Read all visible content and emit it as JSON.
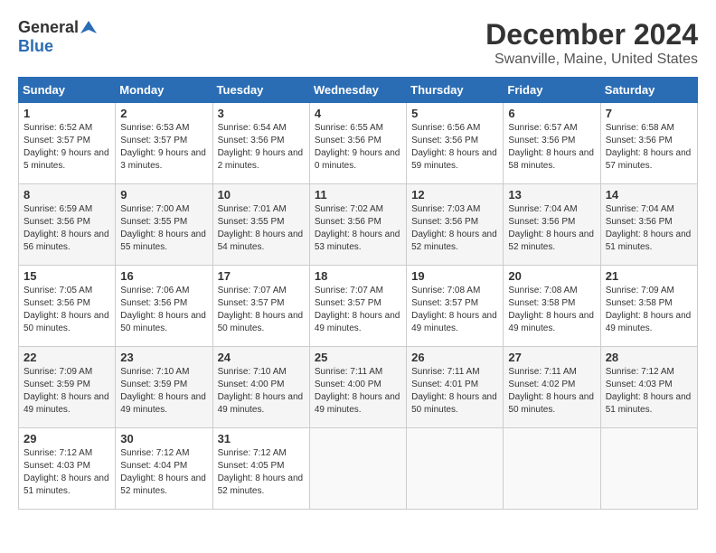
{
  "logo": {
    "general": "General",
    "blue": "Blue"
  },
  "title": "December 2024",
  "location": "Swanville, Maine, United States",
  "days_of_week": [
    "Sunday",
    "Monday",
    "Tuesday",
    "Wednesday",
    "Thursday",
    "Friday",
    "Saturday"
  ],
  "weeks": [
    [
      {
        "day": 1,
        "sunrise": "6:52 AM",
        "sunset": "3:57 PM",
        "daylight": "9 hours and 5 minutes."
      },
      {
        "day": 2,
        "sunrise": "6:53 AM",
        "sunset": "3:57 PM",
        "daylight": "9 hours and 3 minutes."
      },
      {
        "day": 3,
        "sunrise": "6:54 AM",
        "sunset": "3:56 PM",
        "daylight": "9 hours and 2 minutes."
      },
      {
        "day": 4,
        "sunrise": "6:55 AM",
        "sunset": "3:56 PM",
        "daylight": "9 hours and 0 minutes."
      },
      {
        "day": 5,
        "sunrise": "6:56 AM",
        "sunset": "3:56 PM",
        "daylight": "8 hours and 59 minutes."
      },
      {
        "day": 6,
        "sunrise": "6:57 AM",
        "sunset": "3:56 PM",
        "daylight": "8 hours and 58 minutes."
      },
      {
        "day": 7,
        "sunrise": "6:58 AM",
        "sunset": "3:56 PM",
        "daylight": "8 hours and 57 minutes."
      }
    ],
    [
      {
        "day": 8,
        "sunrise": "6:59 AM",
        "sunset": "3:56 PM",
        "daylight": "8 hours and 56 minutes."
      },
      {
        "day": 9,
        "sunrise": "7:00 AM",
        "sunset": "3:55 PM",
        "daylight": "8 hours and 55 minutes."
      },
      {
        "day": 10,
        "sunrise": "7:01 AM",
        "sunset": "3:55 PM",
        "daylight": "8 hours and 54 minutes."
      },
      {
        "day": 11,
        "sunrise": "7:02 AM",
        "sunset": "3:56 PM",
        "daylight": "8 hours and 53 minutes."
      },
      {
        "day": 12,
        "sunrise": "7:03 AM",
        "sunset": "3:56 PM",
        "daylight": "8 hours and 52 minutes."
      },
      {
        "day": 13,
        "sunrise": "7:04 AM",
        "sunset": "3:56 PM",
        "daylight": "8 hours and 52 minutes."
      },
      {
        "day": 14,
        "sunrise": "7:04 AM",
        "sunset": "3:56 PM",
        "daylight": "8 hours and 51 minutes."
      }
    ],
    [
      {
        "day": 15,
        "sunrise": "7:05 AM",
        "sunset": "3:56 PM",
        "daylight": "8 hours and 50 minutes."
      },
      {
        "day": 16,
        "sunrise": "7:06 AM",
        "sunset": "3:56 PM",
        "daylight": "8 hours and 50 minutes."
      },
      {
        "day": 17,
        "sunrise": "7:07 AM",
        "sunset": "3:57 PM",
        "daylight": "8 hours and 50 minutes."
      },
      {
        "day": 18,
        "sunrise": "7:07 AM",
        "sunset": "3:57 PM",
        "daylight": "8 hours and 49 minutes."
      },
      {
        "day": 19,
        "sunrise": "7:08 AM",
        "sunset": "3:57 PM",
        "daylight": "8 hours and 49 minutes."
      },
      {
        "day": 20,
        "sunrise": "7:08 AM",
        "sunset": "3:58 PM",
        "daylight": "8 hours and 49 minutes."
      },
      {
        "day": 21,
        "sunrise": "7:09 AM",
        "sunset": "3:58 PM",
        "daylight": "8 hours and 49 minutes."
      }
    ],
    [
      {
        "day": 22,
        "sunrise": "7:09 AM",
        "sunset": "3:59 PM",
        "daylight": "8 hours and 49 minutes."
      },
      {
        "day": 23,
        "sunrise": "7:10 AM",
        "sunset": "3:59 PM",
        "daylight": "8 hours and 49 minutes."
      },
      {
        "day": 24,
        "sunrise": "7:10 AM",
        "sunset": "4:00 PM",
        "daylight": "8 hours and 49 minutes."
      },
      {
        "day": 25,
        "sunrise": "7:11 AM",
        "sunset": "4:00 PM",
        "daylight": "8 hours and 49 minutes."
      },
      {
        "day": 26,
        "sunrise": "7:11 AM",
        "sunset": "4:01 PM",
        "daylight": "8 hours and 50 minutes."
      },
      {
        "day": 27,
        "sunrise": "7:11 AM",
        "sunset": "4:02 PM",
        "daylight": "8 hours and 50 minutes."
      },
      {
        "day": 28,
        "sunrise": "7:12 AM",
        "sunset": "4:03 PM",
        "daylight": "8 hours and 51 minutes."
      }
    ],
    [
      {
        "day": 29,
        "sunrise": "7:12 AM",
        "sunset": "4:03 PM",
        "daylight": "8 hours and 51 minutes."
      },
      {
        "day": 30,
        "sunrise": "7:12 AM",
        "sunset": "4:04 PM",
        "daylight": "8 hours and 52 minutes."
      },
      {
        "day": 31,
        "sunrise": "7:12 AM",
        "sunset": "4:05 PM",
        "daylight": "8 hours and 52 minutes."
      },
      null,
      null,
      null,
      null
    ]
  ]
}
